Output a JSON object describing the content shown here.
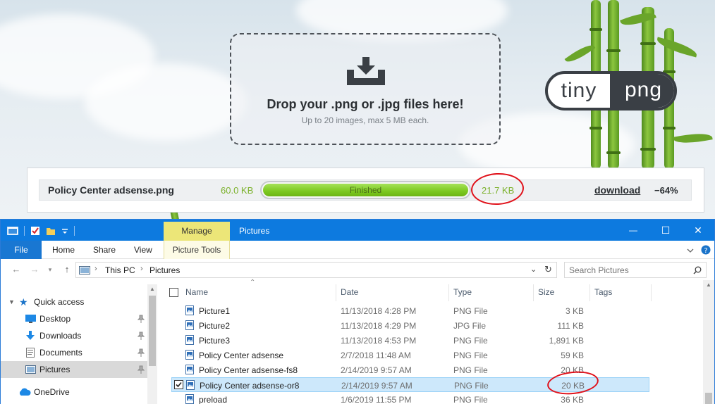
{
  "web": {
    "drop_title": "Drop your .png or .jpg files here!",
    "drop_subtitle": "Up to 20 images, max 5 MB each.",
    "logo_left": "tiny",
    "logo_right": "png",
    "result": {
      "file_name": "Policy Center adsense.png",
      "original_size": "60.0 KB",
      "progress_label": "Finished",
      "progress_fraction": 1.0,
      "new_size": "21.7 KB",
      "download_label": "download",
      "savings": "−64%"
    },
    "colors": {
      "accent_green": "#7bb12b",
      "annotation_red": "#e0111a"
    }
  },
  "explorer": {
    "title": "Pictures",
    "manage_tab": "Manage",
    "ribbon_tabs": {
      "file": "File",
      "home": "Home",
      "share": "Share",
      "view": "View",
      "picture_tools": "Picture Tools"
    },
    "window_buttons": {
      "minimize": "—",
      "maximize": "☐",
      "close": "✕"
    },
    "breadcrumb": {
      "root": "This PC",
      "folder": "Pictures"
    },
    "search_placeholder": "Search Pictures",
    "nav": {
      "quick_access": "Quick access",
      "desktop": "Desktop",
      "downloads": "Downloads",
      "documents": "Documents",
      "pictures": "Pictures",
      "onedrive": "OneDrive"
    },
    "columns": {
      "name": "Name",
      "date": "Date",
      "type": "Type",
      "size": "Size",
      "tags": "Tags"
    },
    "files": [
      {
        "name": "Picture1",
        "date": "11/13/2018 4:28 PM",
        "type": "PNG File",
        "size": "3 KB"
      },
      {
        "name": "Picture2",
        "date": "11/13/2018 4:29 PM",
        "type": "JPG File",
        "size": "111 KB"
      },
      {
        "name": "Picture3",
        "date": "11/13/2018 4:53 PM",
        "type": "PNG File",
        "size": "1,891 KB"
      },
      {
        "name": "Policy Center adsense",
        "date": "2/7/2018 11:48 AM",
        "type": "PNG File",
        "size": "59 KB"
      },
      {
        "name": "Policy Center adsense-fs8",
        "date": "2/14/2019 9:57 AM",
        "type": "PNG File",
        "size": "20 KB"
      },
      {
        "name": "Policy Center adsense-or8",
        "date": "2/14/2019 9:57 AM",
        "type": "PNG File",
        "size": "20 KB"
      },
      {
        "name": "preload",
        "date": "1/6/2019 11:55 PM",
        "type": "PNG File",
        "size": "36 KB"
      }
    ],
    "selected_index": 5,
    "colors": {
      "titlebar": "#0d7adf",
      "manage_tab": "#ece678",
      "selection": "#cde8fb"
    }
  }
}
